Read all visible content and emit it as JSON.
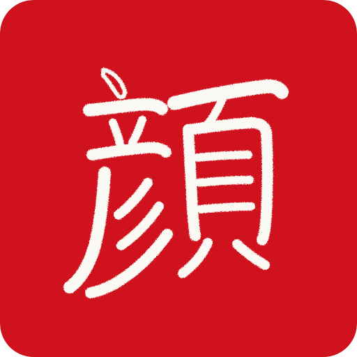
{
  "app_icon": {
    "name": "calligraphy-app-icon",
    "glyph": "顏",
    "colors": {
      "background": "#D0121E",
      "stroke": "#FAF9F4",
      "stroke_shadow": "#E9E6DC"
    }
  }
}
